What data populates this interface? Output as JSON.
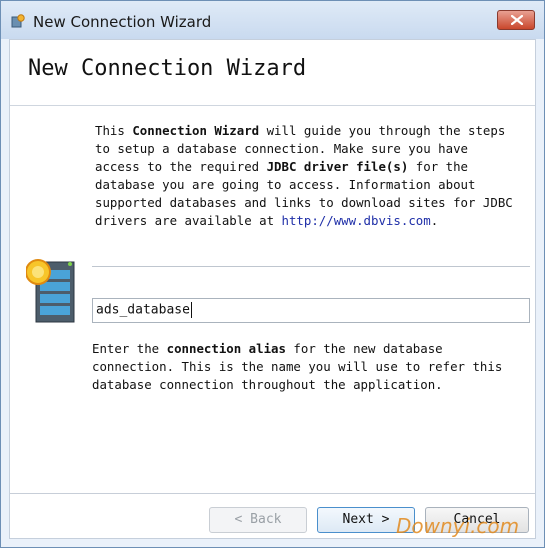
{
  "window": {
    "title": "New Connection Wizard",
    "close_icon": "close-icon"
  },
  "header": {
    "title": "New Connection Wizard"
  },
  "intro": {
    "t1": "This ",
    "b1": "Connection Wizard",
    "t2": " will guide you through the steps to setup a database connection. Make sure you have access to the required ",
    "b2": "JDBC driver file(s)",
    "t3": " for the database you are going to access. Information about supported databases and links to download sites for JDBC drivers are available at ",
    "link": "http://www.dbvis.com",
    "t4": "."
  },
  "alias": {
    "value": "ads_database",
    "help_t1": "Enter the ",
    "help_b1": "connection alias",
    "help_t2": " for the new database connection. This is the name you will use to refer this database connection throughout the application."
  },
  "buttons": {
    "back": "< Back",
    "next": "Next >",
    "cancel": "Cancel"
  },
  "watermark": "Downyi.com",
  "colors": {
    "link": "#1f2fa8",
    "close_button": "#c9472c",
    "next_border": "#4a8fcc"
  }
}
